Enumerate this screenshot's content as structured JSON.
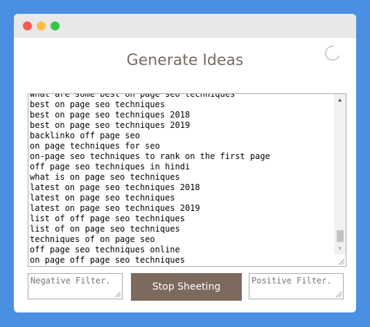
{
  "header": {
    "title": "Generate Ideas"
  },
  "results": {
    "lines": [
      "what are some best on page seo techniques",
      "best on page seo techniques",
      "best on page seo techniques 2018",
      "best on page seo techniques 2019",
      "backlinko off page seo",
      "on page techniques for seo",
      "on-page seo techniques to rank on the first page",
      "off page seo techniques in hindi",
      "what is on page seo techniques",
      "latest on page seo techniques 2018",
      "latest on page seo techniques",
      "latest on page seo techniques 2019",
      "list of off page seo techniques",
      "list of on page seo techniques",
      "techniques of on page seo",
      "off page seo techniques online",
      "on page off page seo techniques"
    ]
  },
  "filters": {
    "negative_placeholder": "Negative Filter.",
    "positive_placeholder": "Positive Filter."
  },
  "actions": {
    "stop_label": "Stop Sheeting"
  },
  "colors": {
    "background": "#4a90e2",
    "title": "#7a6a60",
    "button": "#7d6a5e"
  },
  "icons": {
    "loading": "loading-spinner-icon",
    "scroll_up": "scroll-up-arrow-icon",
    "scroll_down": "scroll-down-arrow-icon",
    "resize": "resize-handle-icon"
  }
}
